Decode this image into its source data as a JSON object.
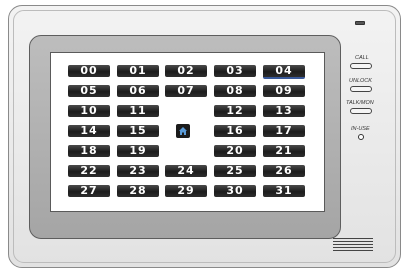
{
  "cells": [
    "00",
    "01",
    "02",
    "03",
    "04",
    "05",
    "06",
    "07",
    "08",
    "09",
    "10",
    "11",
    "12",
    "13",
    "14",
    "15",
    "16",
    "17",
    "18",
    "19",
    "20",
    "21",
    "22",
    "23",
    "24",
    "25",
    "26",
    "27",
    "28",
    "29",
    "30",
    "31"
  ],
  "controls": {
    "call": "CALL",
    "unlock": "UNLOCK",
    "talk_mon": "TALK/MON",
    "in_use": "IN-USE"
  },
  "icons": {
    "home": "home-icon"
  },
  "colors": {
    "cell_bg": "#1c1c1c",
    "home_icon": "#5a9bd8",
    "selection": "#3a5a9a"
  }
}
